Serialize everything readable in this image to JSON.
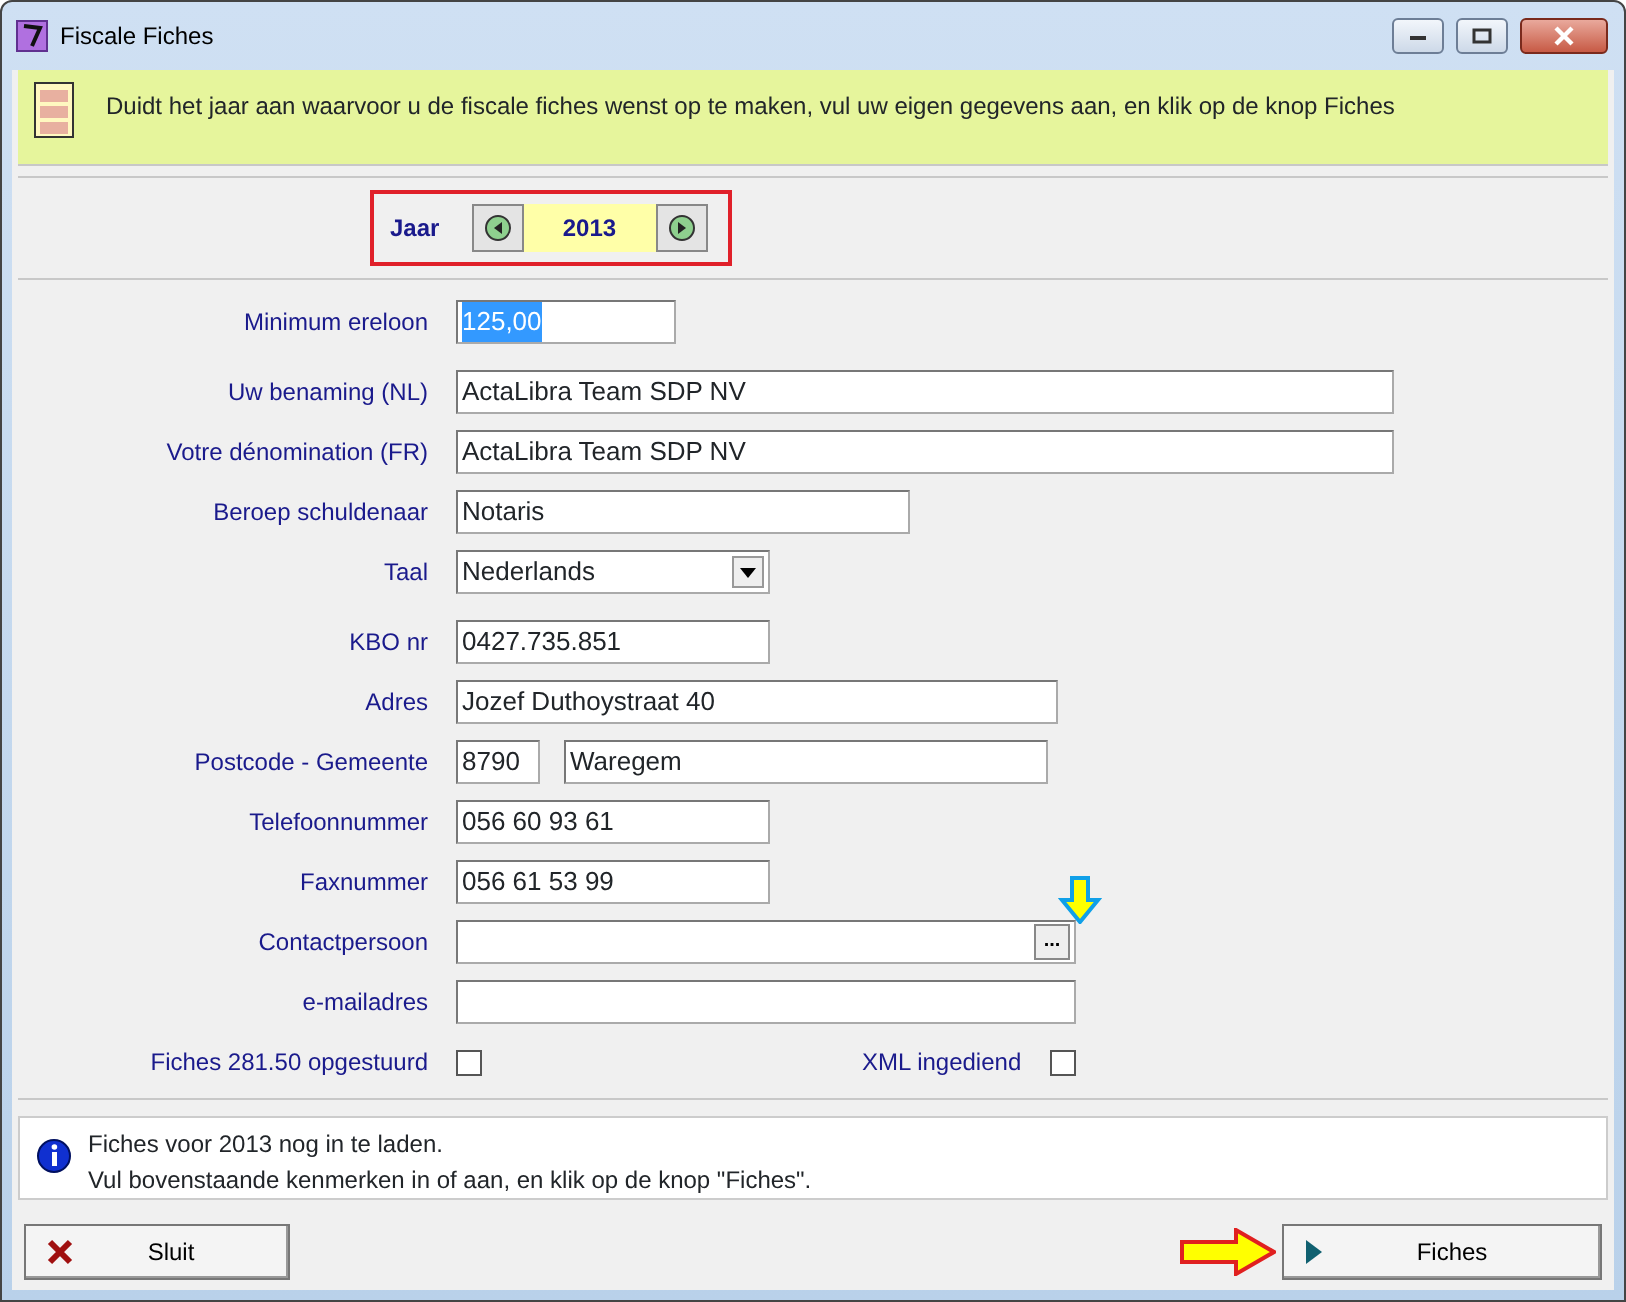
{
  "window": {
    "title": "Fiscale Fiches"
  },
  "banner": {
    "text": "Duidt het jaar aan waarvoor u de fiscale fiches wenst op te maken, vul uw eigen gegevens aan, en klik op de knop Fiches"
  },
  "year": {
    "label": "Jaar",
    "value": "2013"
  },
  "fields": [
    {
      "kind": "text",
      "label": "Minimum ereloon",
      "value": "125,00",
      "highlighted": true
    },
    {
      "kind": "text",
      "label": "Uw benaming (NL)",
      "value": "ActaLibra Team SDP NV",
      "highlighted": false
    },
    {
      "kind": "text",
      "label": "Votre dénomination (FR)",
      "value": "ActaLibra Team SDP NV",
      "highlighted": false
    },
    {
      "kind": "text",
      "label": "Beroep schuldenaar",
      "value": "Notaris",
      "highlighted": false
    },
    {
      "kind": "select",
      "label": "Taal",
      "value": "Nederlands",
      "highlighted": false
    },
    {
      "kind": "text",
      "label": "KBO nr",
      "value": "0427.735.851",
      "highlighted": false
    },
    {
      "kind": "text",
      "label": "Adres",
      "value": "Jozef Duthoystraat 40",
      "highlighted": false
    },
    {
      "kind": "pair",
      "label": "Postcode - Gemeente",
      "value": "8790",
      "value2": "Waregem",
      "highlighted": false
    },
    {
      "kind": "text",
      "label": "Telefoonnummer",
      "value": "056 60 93 61",
      "highlighted": false
    },
    {
      "kind": "text",
      "label": "Faxnummer",
      "value": "056 61 53 99",
      "highlighted": false
    },
    {
      "kind": "lookup",
      "label": "Contactpersoon",
      "button": "..."
    },
    {
      "kind": "text",
      "label": "e-mailadres"
    }
  ],
  "checkboxes": [
    {
      "label": "Fiches 281.50 opgestuurd",
      "checked": false
    },
    {
      "label": "XML ingediend",
      "checked": false
    }
  ],
  "info": {
    "lines": [
      "Fiches voor 2013 nog in te laden.",
      "Vul bovenstaande kenmerken in of aan, en klik op de knop \"Fiches\"."
    ]
  },
  "buttons": [
    {
      "kind": "close",
      "label": "Sluit"
    },
    {
      "kind": "go",
      "label": "Fiches"
    }
  ]
}
